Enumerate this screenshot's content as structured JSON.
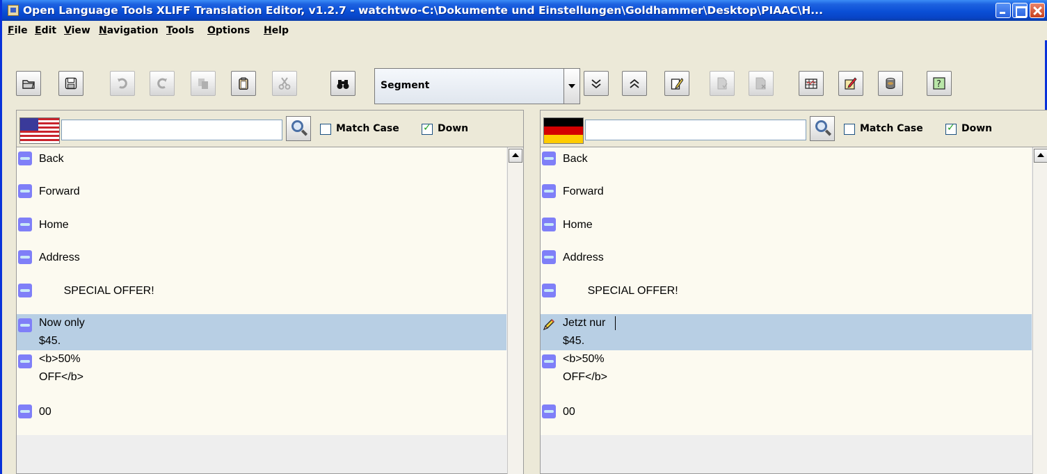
{
  "window": {
    "title": "Open Language Tools XLIFF Translation Editor, v1.2.7 - watchtwo-C:\\Dokumente und Einstellungen\\Goldhammer\\Desktop\\PIAAC\\H..."
  },
  "menu": {
    "items": [
      "File",
      "Edit",
      "View",
      "Navigation",
      "Tools",
      "Options",
      "Help"
    ]
  },
  "toolbar": {
    "mode_select": {
      "value": "Segment"
    },
    "buttons": [
      "open-icon",
      "save-icon",
      "undo-icon",
      "redo-icon",
      "copy-icon",
      "paste-icon",
      "cut-icon",
      "find-icon",
      "next-icon",
      "previous-icon",
      "edit-icon",
      "copy-source-icon",
      "clear-target-icon",
      "table-icon",
      "mark-icon",
      "database-icon",
      "help-icon"
    ]
  },
  "source": {
    "language_flag": "us-flag-icon",
    "search": {
      "value": ""
    },
    "match_case": {
      "label": "Match Case",
      "checked": false
    },
    "down": {
      "label": "Down",
      "checked": true
    },
    "segments": [
      {
        "text": "Back"
      },
      {
        "text": "Forward"
      },
      {
        "text": "Home"
      },
      {
        "text": "Address"
      },
      {
        "text": "        SPECIAL OFFER!"
      },
      {
        "text": "Now only\n$45.",
        "selected": true
      },
      {
        "text": "<b>50%\nOFF</b>"
      },
      {
        "text": "00"
      }
    ]
  },
  "target": {
    "language_flag": "de-flag-icon",
    "search": {
      "value": ""
    },
    "match_case": {
      "label": "Match Case",
      "checked": false
    },
    "down": {
      "label": "Down",
      "checked": true
    },
    "segments": [
      {
        "text": "Back"
      },
      {
        "text": "Forward"
      },
      {
        "text": "Home"
      },
      {
        "text": "Address"
      },
      {
        "text": "        SPECIAL OFFER!"
      },
      {
        "text": "Jetzt nur\n$45.",
        "selected": true,
        "editing": true
      },
      {
        "text": "<b>50%\nOFF</b>"
      },
      {
        "text": "00"
      }
    ]
  },
  "colors": {
    "selection": "#b8cfe4",
    "segment_background": "#fcfaf0",
    "title_bar": "#0a4fd6"
  }
}
